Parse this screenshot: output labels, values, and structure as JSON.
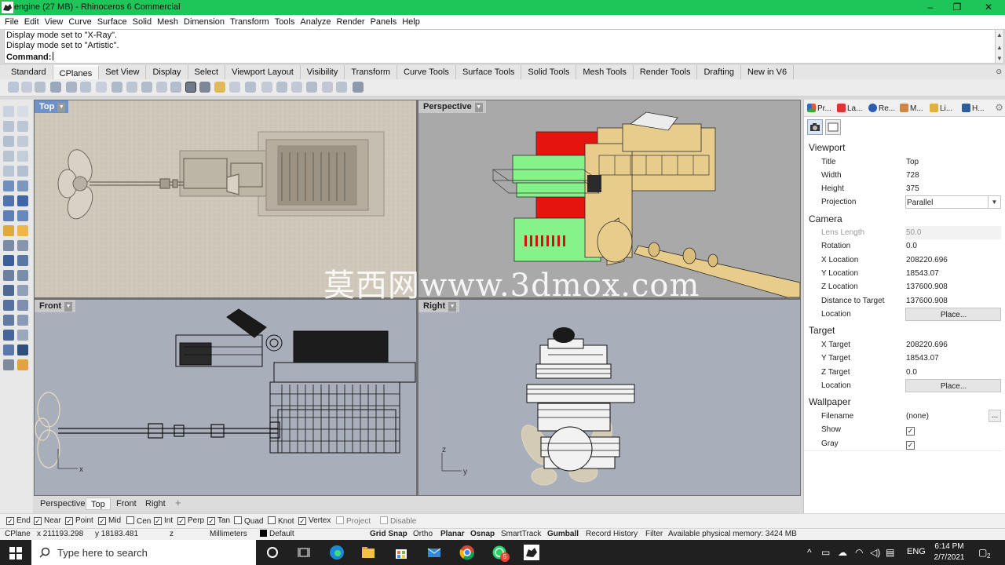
{
  "window": {
    "title": "engine (27 MB) - Rhinoceros 6 Commercial",
    "controls": [
      "–",
      "❐",
      "✕"
    ]
  },
  "menu": [
    "File",
    "Edit",
    "View",
    "Curve",
    "Surface",
    "Solid",
    "Mesh",
    "Dimension",
    "Transform",
    "Tools",
    "Analyze",
    "Render",
    "Panels",
    "Help"
  ],
  "command": {
    "history": [
      "Display mode set to \"X-Ray\".",
      "Display mode set to \"Artistic\"."
    ],
    "prompt": "Command:"
  },
  "toolbar_tabs": [
    "Standard",
    "CPlanes",
    "Set View",
    "Display",
    "Select",
    "Viewport Layout",
    "Visibility",
    "Transform",
    "Curve Tools",
    "Surface Tools",
    "Solid Tools",
    "Mesh Tools",
    "Render Tools",
    "Drafting",
    "New in V6"
  ],
  "active_toolbar_tab": "CPlanes",
  "viewports": {
    "top": "Top",
    "perspective": "Perspective",
    "front": "Front",
    "right": "Right"
  },
  "axis_labels": {
    "front_x": "x",
    "right_z": "z",
    "right_y": "y"
  },
  "watermark": "莫西网www.3dmox.com",
  "viewport_tabs": [
    "Perspective",
    "Top",
    "Front",
    "Right"
  ],
  "active_viewport_tab": "Top",
  "panel": {
    "tabs": [
      "Pr...",
      "La...",
      "Re...",
      "M...",
      "Li...",
      "H..."
    ],
    "sections": {
      "viewport": {
        "header": "Viewport",
        "rows": [
          {
            "key": "Title",
            "value": "Top"
          },
          {
            "key": "Width",
            "value": "728"
          },
          {
            "key": "Height",
            "value": "375"
          },
          {
            "key": "Projection",
            "value": "Parallel"
          }
        ]
      },
      "camera": {
        "header": "Camera",
        "rows": [
          {
            "key": "Lens Length",
            "value": "50.0"
          },
          {
            "key": "Rotation",
            "value": "0.0"
          },
          {
            "key": "X Location",
            "value": "208220.696"
          },
          {
            "key": "Y Location",
            "value": "18543.07"
          },
          {
            "key": "Z Location",
            "value": "137600.908"
          },
          {
            "key": "Distance to Target",
            "value": "137600.908"
          },
          {
            "key": "Location",
            "value": "Place..."
          }
        ]
      },
      "target": {
        "header": "Target",
        "rows": [
          {
            "key": "X Target",
            "value": "208220.696"
          },
          {
            "key": "Y Target",
            "value": "18543.07"
          },
          {
            "key": "Z Target",
            "value": "0.0"
          },
          {
            "key": "Location",
            "value": "Place..."
          }
        ]
      },
      "wallpaper": {
        "header": "Wallpaper",
        "rows": [
          {
            "key": "Filename",
            "value": "(none)"
          },
          {
            "key": "Show",
            "value": "✓"
          },
          {
            "key": "Gray",
            "value": "✓"
          }
        ],
        "browse": "..."
      }
    }
  },
  "osnaps": [
    {
      "label": "End",
      "checked": true
    },
    {
      "label": "Near",
      "checked": true
    },
    {
      "label": "Point",
      "checked": true
    },
    {
      "label": "Mid",
      "checked": true
    },
    {
      "label": "Cen",
      "checked": false
    },
    {
      "label": "Int",
      "checked": true
    },
    {
      "label": "Perp",
      "checked": true
    },
    {
      "label": "Tan",
      "checked": true
    },
    {
      "label": "Quad",
      "checked": false
    },
    {
      "label": "Knot",
      "checked": false
    },
    {
      "label": "Vertex",
      "checked": true
    },
    {
      "label": "Project",
      "checked": false
    },
    {
      "label": "Disable",
      "checked": false
    }
  ],
  "status": {
    "cplane": "CPlane",
    "x": "x 211193.298",
    "y": "y 18183.481",
    "z": "z",
    "units": "Millimeters",
    "layer": "Default",
    "grid_snap": "Grid Snap",
    "ortho": "Ortho",
    "planar": "Planar",
    "osnap": "Osnap",
    "smarttrack": "SmartTrack",
    "gumball": "Gumball",
    "record_history": "Record History",
    "filter": "Filter",
    "memory": "Available physical memory: 3424 MB"
  },
  "taskbar": {
    "search_placeholder": "Type here to search",
    "language": "ENG",
    "time": "6:14 PM",
    "date": "2/7/2021",
    "notifications": "2",
    "whatsapp_badge": "5"
  },
  "colors": {
    "titlebar": "#1ec65a",
    "active_viewport_label": "#6d92c9",
    "engine_red": "#e5140f",
    "engine_green": "#86f28a",
    "engine_tan": "#e8cc8c"
  }
}
